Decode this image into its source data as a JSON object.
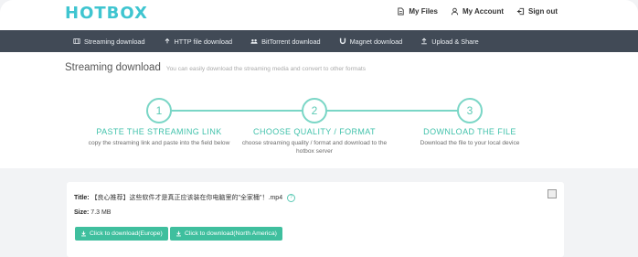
{
  "brand": {
    "logo": "HOTBOX",
    "accent": "#3fc5d0",
    "nav_bg": "#414a56",
    "green": "#3fbf9e"
  },
  "header": {
    "links": [
      {
        "label": "My Files",
        "icon": "file-icon"
      },
      {
        "label": "My Account",
        "icon": "user-icon"
      },
      {
        "label": "Sign out",
        "icon": "sign-out-icon"
      }
    ]
  },
  "nav": {
    "items": [
      {
        "label": "Streaming download",
        "icon": "film-icon"
      },
      {
        "label": "HTTP file download",
        "icon": "upload-icon"
      },
      {
        "label": "BitTorrent download",
        "icon": "group-icon"
      },
      {
        "label": "Magnet download",
        "icon": "magnet-icon"
      },
      {
        "label": "Upload & Share",
        "icon": "upload-icon"
      }
    ]
  },
  "page": {
    "title": "Streaming download",
    "subtitle": "You can easily download the streaming media and convert to other formats"
  },
  "steps": [
    {
      "number": "1",
      "title": "PASTE THE STREAMING LINK",
      "desc": "copy the streaming link and paste into the field below"
    },
    {
      "number": "2",
      "title": "CHOOSE QUALITY / FORMAT",
      "desc": "choose streaming quality / format and download to the hotbox server"
    },
    {
      "number": "3",
      "title": "DOWNLOAD THE FILE",
      "desc": "Download the file to your local device"
    }
  ],
  "result": {
    "title_label": "Title:",
    "title_value": "【良心推荐】这些软件才是真正应该装在你电脑里的\"全家桶\"！.mp4",
    "size_label": "Size:",
    "size_value": "7.3 MB",
    "buttons": [
      {
        "label": "Click to download(Europe)"
      },
      {
        "label": "Click to download(North America)"
      }
    ]
  }
}
